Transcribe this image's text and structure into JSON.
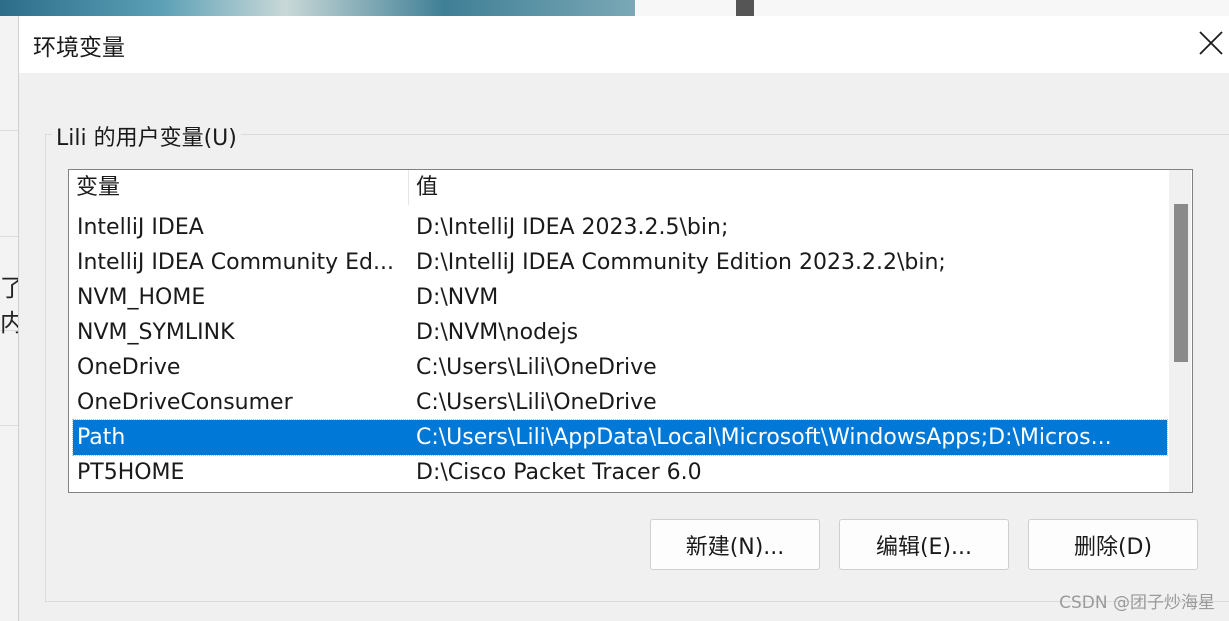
{
  "dialog": {
    "title": "环境变量",
    "close_icon": "close-icon"
  },
  "user_vars": {
    "group_label": "Lili 的用户变量(U)",
    "columns": [
      "变量",
      "值"
    ],
    "rows": [
      {
        "name": "IntelliJ IDEA",
        "value": "D:\\IntelliJ IDEA 2023.2.5\\bin;"
      },
      {
        "name": "IntelliJ IDEA Community Ed...",
        "value": "D:\\IntelliJ IDEA Community Edition 2023.2.2\\bin;"
      },
      {
        "name": "NVM_HOME",
        "value": "D:\\NVM"
      },
      {
        "name": "NVM_SYMLINK",
        "value": "D:\\NVM\\nodejs"
      },
      {
        "name": "OneDrive",
        "value": "C:\\Users\\Lili\\OneDrive"
      },
      {
        "name": "OneDriveConsumer",
        "value": "C:\\Users\\Lili\\OneDrive"
      },
      {
        "name": "Path",
        "value": "C:\\Users\\Lili\\AppData\\Local\\Microsoft\\WindowsApps;D:\\Micros..."
      },
      {
        "name": "PT5HOME",
        "value": "D:\\Cisco Packet Tracer 6.0"
      }
    ],
    "selected_row": "Path"
  },
  "buttons": {
    "new": "新建(N)...",
    "edit": "编辑(E)...",
    "delete": "删除(D)"
  },
  "watermark": "CSDN @团子炒海星",
  "background_glyph": "了内"
}
